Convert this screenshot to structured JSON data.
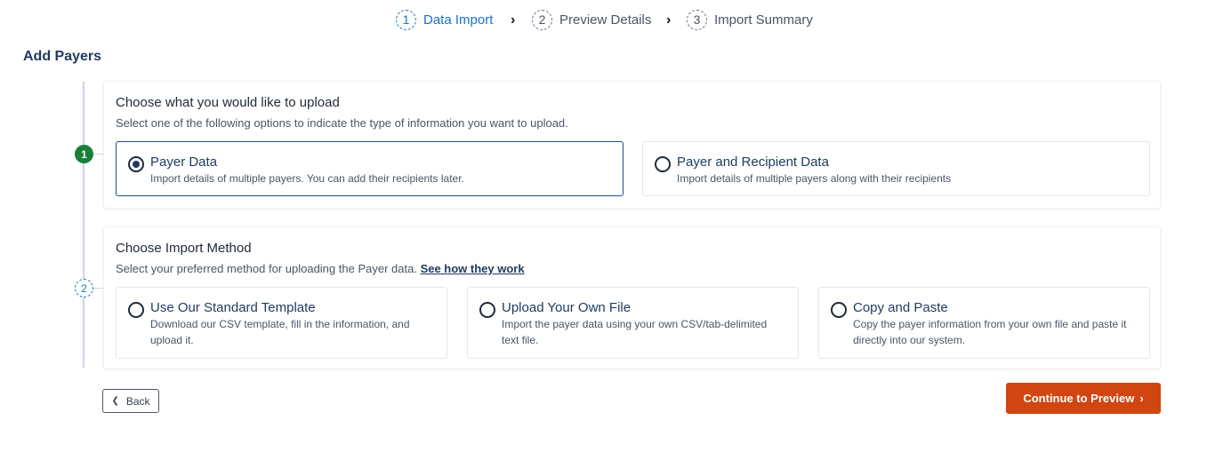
{
  "stepper": {
    "steps": [
      {
        "number": "1",
        "label": "Data Import",
        "active": true
      },
      {
        "number": "2",
        "label": "Preview Details",
        "active": false
      },
      {
        "number": "3",
        "label": "Import Summary",
        "active": false
      }
    ],
    "chevron": "›"
  },
  "page": {
    "title": "Add Payers"
  },
  "section1": {
    "marker": "1",
    "title": "Choose what you would like to upload",
    "subtitle": "Select one of the following options to indicate the type of information you want to upload.",
    "options": [
      {
        "title": "Payer Data",
        "desc": "Import details of multiple payers. You can add their recipients later.",
        "selected": true
      },
      {
        "title": "Payer and Recipient Data",
        "desc": "Import details of multiple payers along with their recipients",
        "selected": false
      }
    ]
  },
  "section2": {
    "marker": "2",
    "title": "Choose Import Method",
    "subtitle": "Select your preferred method for uploading the Payer data.",
    "link": "See how they work",
    "options": [
      {
        "title": "Use Our Standard Template",
        "desc": "Download our CSV template, fill in the information, and upload it.",
        "selected": false
      },
      {
        "title": "Upload Your Own File",
        "desc": "Import the payer data using your own CSV/tab-delimited text file.",
        "selected": false
      },
      {
        "title": "Copy and Paste",
        "desc": "Copy the payer information from your own file and paste it directly into our system.",
        "selected": false
      }
    ]
  },
  "actions": {
    "back_label": "Back",
    "continue_label": "Continue to Preview",
    "accent_color": "#d14510"
  }
}
